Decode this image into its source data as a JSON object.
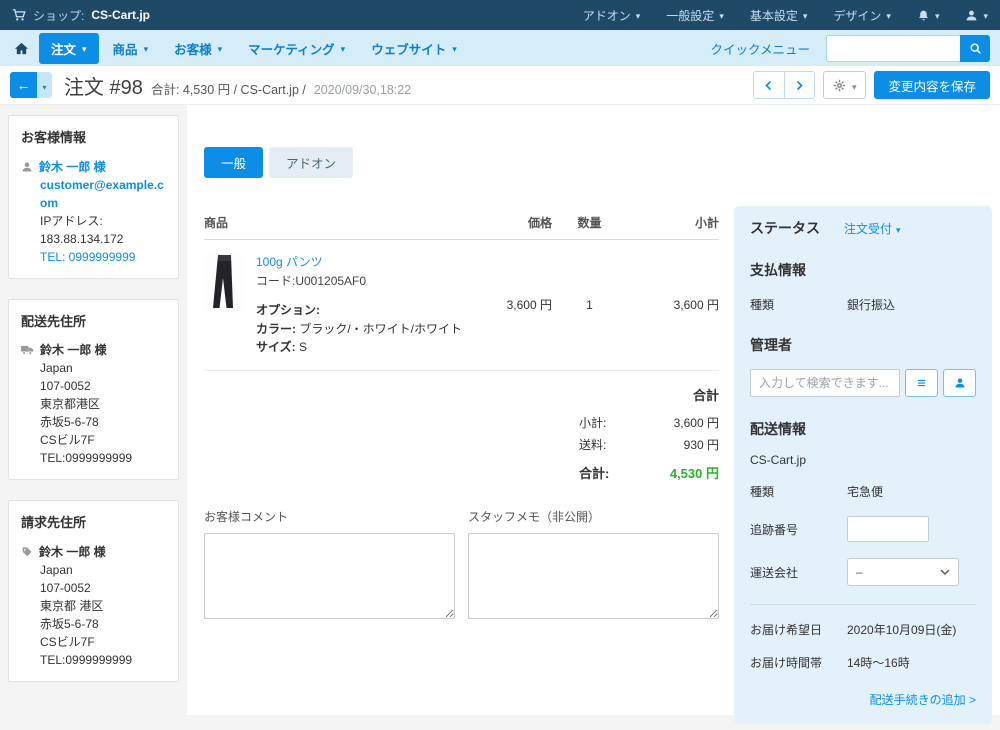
{
  "topbar": {
    "shop_label": "ショップ:",
    "shop_name": "CS-Cart.jp",
    "menus": [
      {
        "label": "アドオン"
      },
      {
        "label": "一般設定"
      },
      {
        "label": "基本設定"
      },
      {
        "label": "デザイン"
      }
    ]
  },
  "nav": {
    "items": [
      {
        "label": "注文"
      },
      {
        "label": "商品"
      },
      {
        "label": "お客様"
      },
      {
        "label": "マーケティング"
      },
      {
        "label": "ウェブサイト"
      }
    ],
    "quick_menu": "クイックメニュー"
  },
  "toolbar": {
    "title": "注文 #98",
    "subtitle": "合計: 4,530 円 / CS-Cart.jp /",
    "date": "2020/09/30,18:22",
    "save_label": "変更内容を保存"
  },
  "customer": {
    "title": "お客様情報",
    "name": "鈴木 一郎 様",
    "email": "customer@example.com",
    "ip_label": "IPアドレス:",
    "ip": "183.88.134.172",
    "tel": "TEL: 0999999999"
  },
  "shipping_address": {
    "title": "配送先住所",
    "name": "鈴木 一郎 様",
    "lines": [
      "Japan",
      "107-0052",
      "東京都港区",
      "赤坂5-6-78",
      "CSビル7F",
      "TEL:0999999999"
    ]
  },
  "billing_address": {
    "title": "請求先住所",
    "name": "鈴木 一郎 様",
    "lines": [
      "Japan",
      "107-0052",
      "東京都 港区",
      "赤坂5-6-78",
      "CSビル7F",
      "TEL:0999999999"
    ]
  },
  "tabs": [
    {
      "label": "一般"
    },
    {
      "label": "アドオン"
    }
  ],
  "order_table": {
    "headers": {
      "product": "商品",
      "price": "価格",
      "qty": "数量",
      "subtotal": "小計"
    },
    "item": {
      "name": "100g パンツ",
      "code": "コード:U001205AF0",
      "options_label": "オプション:",
      "color_label": "カラー:",
      "color_value": "ブラック/・ホワイト/ホワイト",
      "size_label": "サイズ:",
      "size_value": "S",
      "price": "3,600 円",
      "qty": "1",
      "subtotal": "3,600 円"
    },
    "totals": {
      "title": "合計",
      "subtotal_label": "小計:",
      "subtotal": "3,600 円",
      "shipping_label": "送料:",
      "shipping": "930 円",
      "total_label": "合計:",
      "total": "4,530 円"
    }
  },
  "comments": {
    "customer_label": "お客様コメント",
    "staff_label": "スタッフメモ（非公開）"
  },
  "panel": {
    "status_label": "ステータス",
    "status_value": "注文受付",
    "payment_title": "支払情報",
    "payment_type_label": "種類",
    "payment_type_value": "銀行振込",
    "admin_title": "管理者",
    "admin_search_placeholder": "入力して検索できます...",
    "shipping_title": "配送情報",
    "shipping_company": "CS-Cart.jp",
    "shipping_type_label": "種類",
    "shipping_type_value": "宅急便",
    "tracking_label": "追跡番号",
    "carrier_label": "運送会社",
    "carrier_value": "–",
    "delivery_date_label": "お届け希望日",
    "delivery_date_value": "2020年10月09日(金)",
    "delivery_time_label": "お届け時間帯",
    "delivery_time_value": "14時〜16時",
    "add_shipment_link": "配送手続きの追加 >"
  },
  "colors": {
    "accent": "#0d8ee6",
    "topbar": "#1e4a68",
    "total_green": "#2cb22c"
  }
}
